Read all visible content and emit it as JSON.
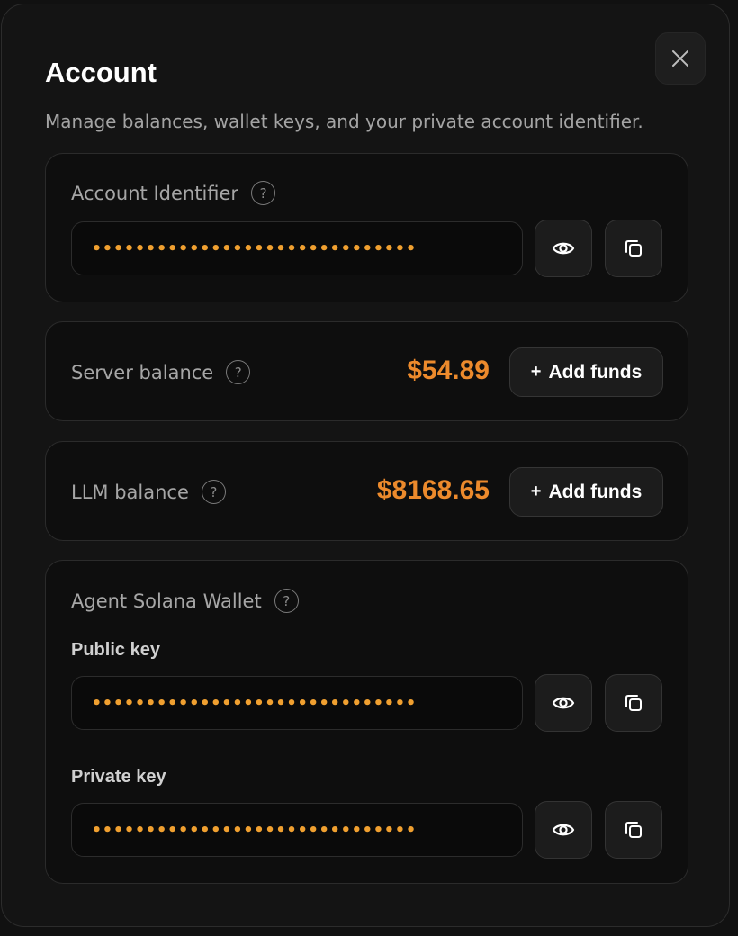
{
  "modal": {
    "title": "Account",
    "subtitle": "Manage balances, wallet keys, and your private account identifier.",
    "close_icon": "close-icon"
  },
  "account_identifier": {
    "label": "Account Identifier",
    "help": "?",
    "masked_value": "••••••••••••••••••••••••••••••"
  },
  "server_balance": {
    "label": "Server balance",
    "help": "?",
    "amount": "$54.89",
    "add_plus": "+",
    "add_label": "Add funds"
  },
  "llm_balance": {
    "label": "LLM balance",
    "help": "?",
    "amount": "$8168.65",
    "add_plus": "+",
    "add_label": "Add funds"
  },
  "wallet": {
    "label": "Agent Solana Wallet",
    "help": "?",
    "public_key_label": "Public key",
    "public_key_masked": "••••••••••••••••••••••••••••••",
    "private_key_label": "Private key",
    "private_key_masked": "••••••••••••••••••••••••••••••"
  },
  "colors": {
    "accent": "#ec8a2c",
    "masked_dots": "#f0a030",
    "background": "#141414"
  },
  "icons": [
    "close-icon",
    "help-icon",
    "eye-icon",
    "copy-icon"
  ]
}
